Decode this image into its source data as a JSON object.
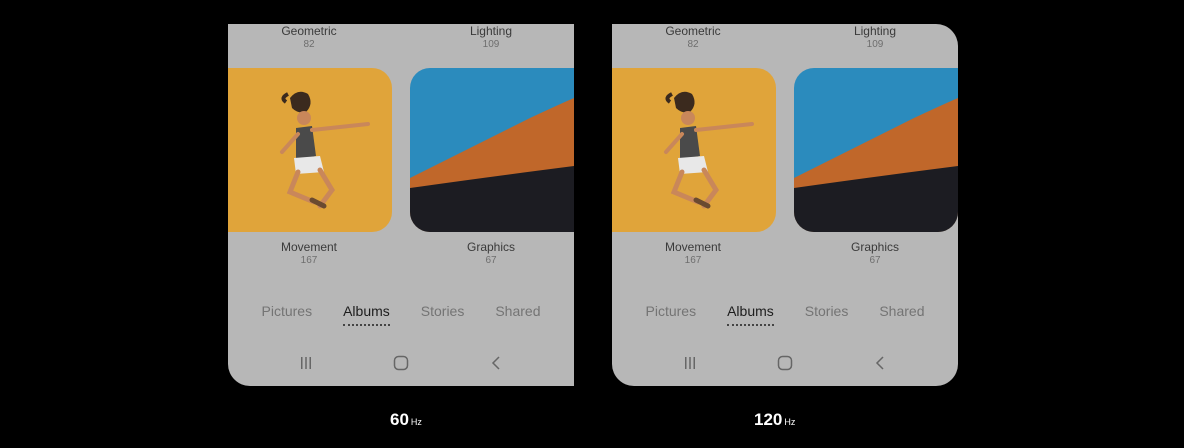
{
  "panels": [
    {
      "id": "60hz",
      "albums_top": [
        {
          "name": "Geometric",
          "count": "82"
        },
        {
          "name": "Lighting",
          "count": "109"
        }
      ],
      "albums_bottom": [
        {
          "name": "Movement",
          "count": "167"
        },
        {
          "name": "Graphics",
          "count": "67"
        }
      ],
      "tabs": [
        "Pictures",
        "Albums",
        "Stories",
        "Shared"
      ],
      "active_tab": "Albums",
      "refresh_label": "60",
      "refresh_unit": "Hz"
    },
    {
      "id": "120hz",
      "albums_top": [
        {
          "name": "Geometric",
          "count": "82"
        },
        {
          "name": "Lighting",
          "count": "109"
        }
      ],
      "albums_bottom": [
        {
          "name": "Movement",
          "count": "167"
        },
        {
          "name": "Graphics",
          "count": "67"
        }
      ],
      "tabs": [
        "Pictures",
        "Albums",
        "Stories",
        "Shared"
      ],
      "active_tab": "Albums",
      "refresh_label": "120",
      "refresh_unit": "Hz"
    }
  ],
  "icons": {
    "recents": "recents-icon",
    "home": "home-icon",
    "back": "back-icon"
  },
  "colors": {
    "background": "#000000",
    "panel": "#b7b7b7",
    "movement_thumb": "#e0a43a",
    "sky": "#2b8bbd",
    "dune": "#c0672a",
    "dune_shadow": "#1c1c22"
  }
}
